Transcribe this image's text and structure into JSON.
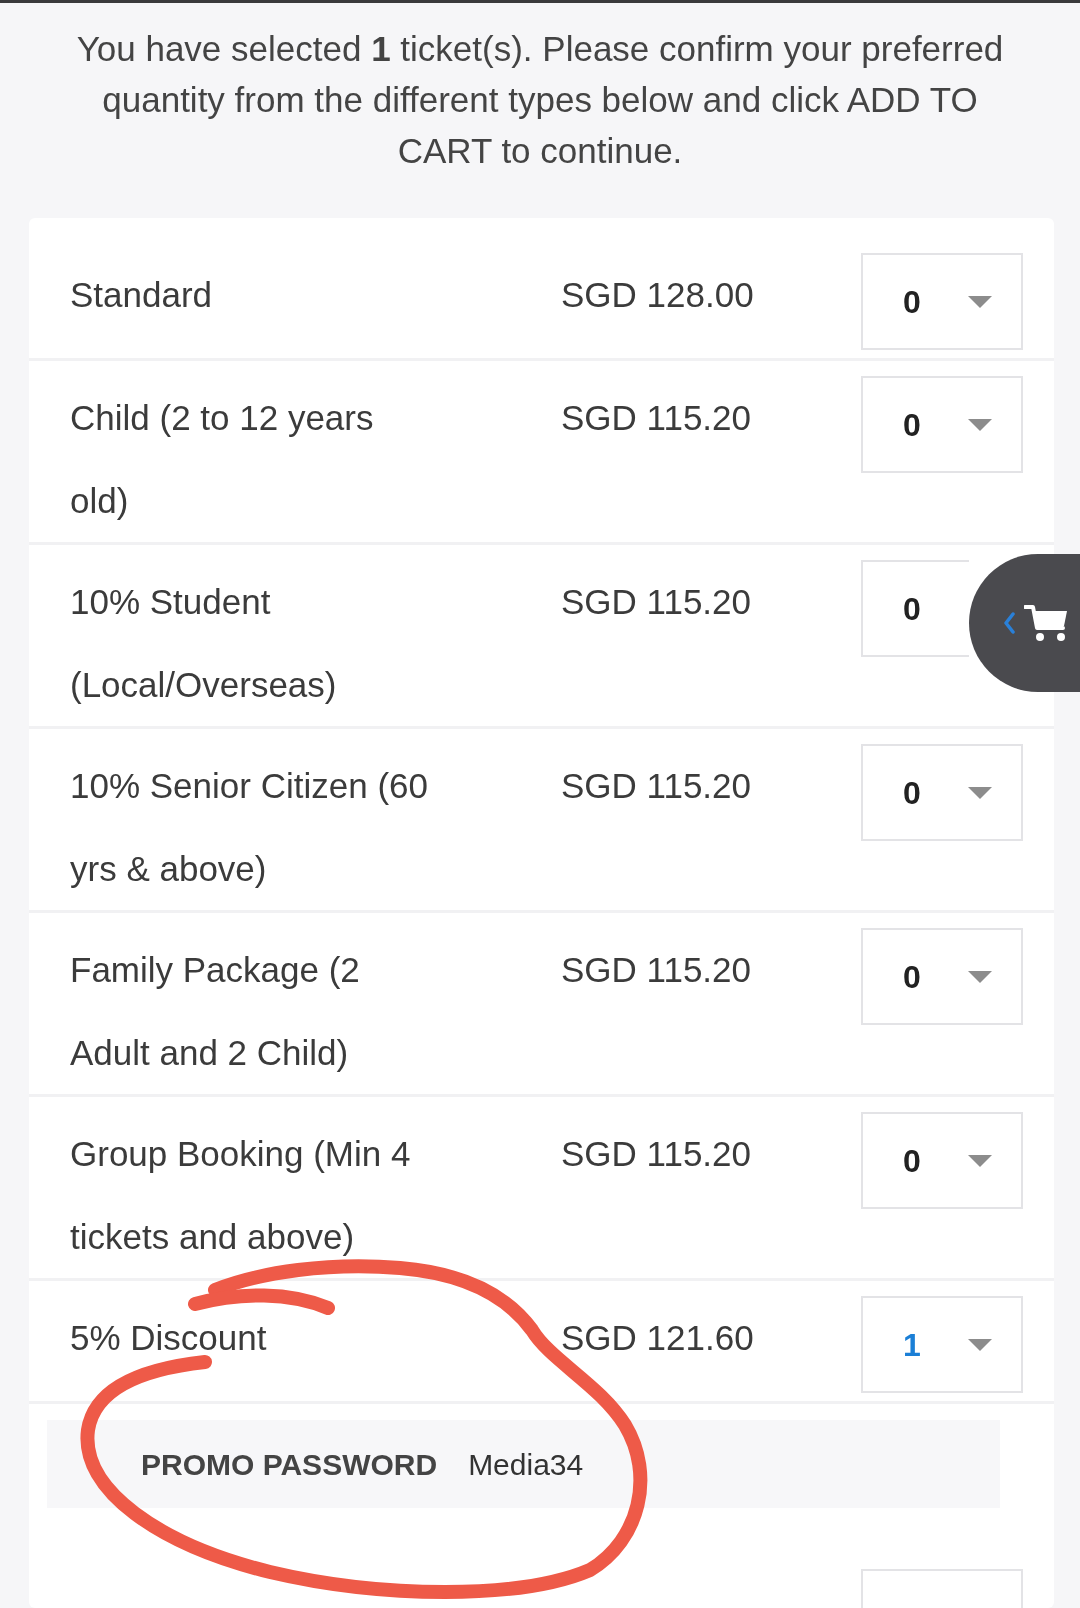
{
  "intro": "You have selected **1** ticket(s). Please confirm your preferred quantity from the different types below and click ADD TO CART to continue.",
  "rows": [
    {
      "kind": "ticket",
      "name": "Standard",
      "price": "SGD 128.00",
      "quantity": "0",
      "highlighted": false
    },
    {
      "kind": "ticket",
      "name": "Child (2 to 12 years old)",
      "price": "SGD 115.20",
      "quantity": "0",
      "highlighted": false
    },
    {
      "kind": "ticket",
      "name": "10% Student (Local/Overseas)",
      "price": "SGD 115.20",
      "quantity": "0",
      "highlighted": false
    },
    {
      "kind": "ticket",
      "name": "10% Senior Citizen (60 yrs & above)",
      "price": "SGD 115.20",
      "quantity": "0",
      "highlighted": false
    },
    {
      "kind": "ticket",
      "name": "Family Package (2 Adult and 2 Child)",
      "price": "SGD 115.20",
      "quantity": "0",
      "highlighted": false
    },
    {
      "kind": "ticket",
      "name": "Group Booking (Min 4 tickets and above)",
      "price": "SGD 115.20",
      "quantity": "0",
      "highlighted": false
    },
    {
      "kind": "ticket",
      "name": "5% Discount",
      "price": "SGD 121.60",
      "quantity": "1",
      "highlighted": true
    },
    {
      "kind": "promo",
      "label": "PROMO PASSWORD",
      "value": "Media34",
      "circled": true
    },
    {
      "kind": "cut_off"
    }
  ]
}
